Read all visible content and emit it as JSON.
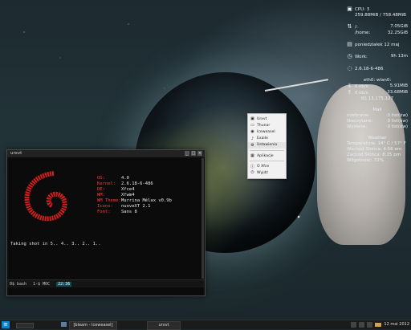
{
  "conky": {
    "cpu": "CPU: 3",
    "ram": "259.88MiB / 758.48MiB",
    "root_label": "/:",
    "root_value": "7.05GiB",
    "home_label": "/home:",
    "home_value": "32.25GiB",
    "date": "poniedziałek 12 maj",
    "work_label": "Work:",
    "work_value": "9h 13m",
    "kernel": "2.6.18-6-486",
    "net_title": "eth0: wlan0:",
    "down_value": "0",
    "down_unit": "kb/s",
    "down_total": "5.91MiB",
    "up_value": "0",
    "up_unit": "kb/s",
    "up_total": "33.68MiB",
    "ip": "83.13.175.127",
    "mail_title": "Mail",
    "mail_rows": [
      {
        "label": "odebrane:",
        "value": "0 list(ów)"
      },
      {
        "label": "Nieczytane:",
        "value": "0 list(ów)"
      },
      {
        "label": "Wysłane:",
        "value": "0 list(ów)"
      }
    ],
    "weather_title": "Weather",
    "weather_rows": [
      "Temperature: 14° C / 57° F",
      "Wschód Słońca: 4:56 am",
      "Zachód Słońca: 8:25 pm",
      "Wilgotność: 72%"
    ]
  },
  "terminal": {
    "title": "urxvt",
    "controls": [
      "_",
      "□",
      "×"
    ],
    "sysinfo": [
      {
        "k": "OS:",
        "v": "4.0"
      },
      {
        "k": "Kernel:",
        "v": "2.6.18-6-486"
      },
      {
        "k": "DE:",
        "v": "Xfce4"
      },
      {
        "k": "WM:",
        "v": "Xfwm4"
      },
      {
        "k": "WM Theme:",
        "v": "Murrina Mélax v0.9b"
      },
      {
        "k": "Icons:",
        "v": "nuoveXT 2.1"
      },
      {
        "k": "Font:",
        "v": "Sans 8"
      }
    ],
    "command": "Taking shot in 5.. 4.. 3.. 2.. 1..",
    "status": {
      "shell": "0$ bash",
      "mode": "1-$ MOC",
      "time": "22:36"
    }
  },
  "context_menu": {
    "items": [
      {
        "label": "Urxvt",
        "icon": "terminal-icon"
      },
      {
        "label": "Thunar",
        "icon": "folder-icon"
      },
      {
        "label": "Iceweasel",
        "icon": "browser-icon"
      },
      {
        "label": "Exaile",
        "icon": "music-icon"
      },
      {
        "label": "Ustawienia",
        "icon": "settings-icon"
      },
      {
        "label": "Aplikacje",
        "icon": "apps-icon"
      },
      {
        "label": "O Xfce",
        "icon": "info-icon"
      },
      {
        "label": "Wyjdź",
        "icon": "logout-icon"
      }
    ]
  },
  "panel": {
    "tasks": [
      {
        "label": "[bleam - Iceweasel]"
      },
      {
        "label": "urxvt"
      }
    ],
    "clock": "12 mai 2012"
  },
  "colors": {
    "accent": "#0b84c6",
    "terminal_red": "#ff3b3b"
  }
}
